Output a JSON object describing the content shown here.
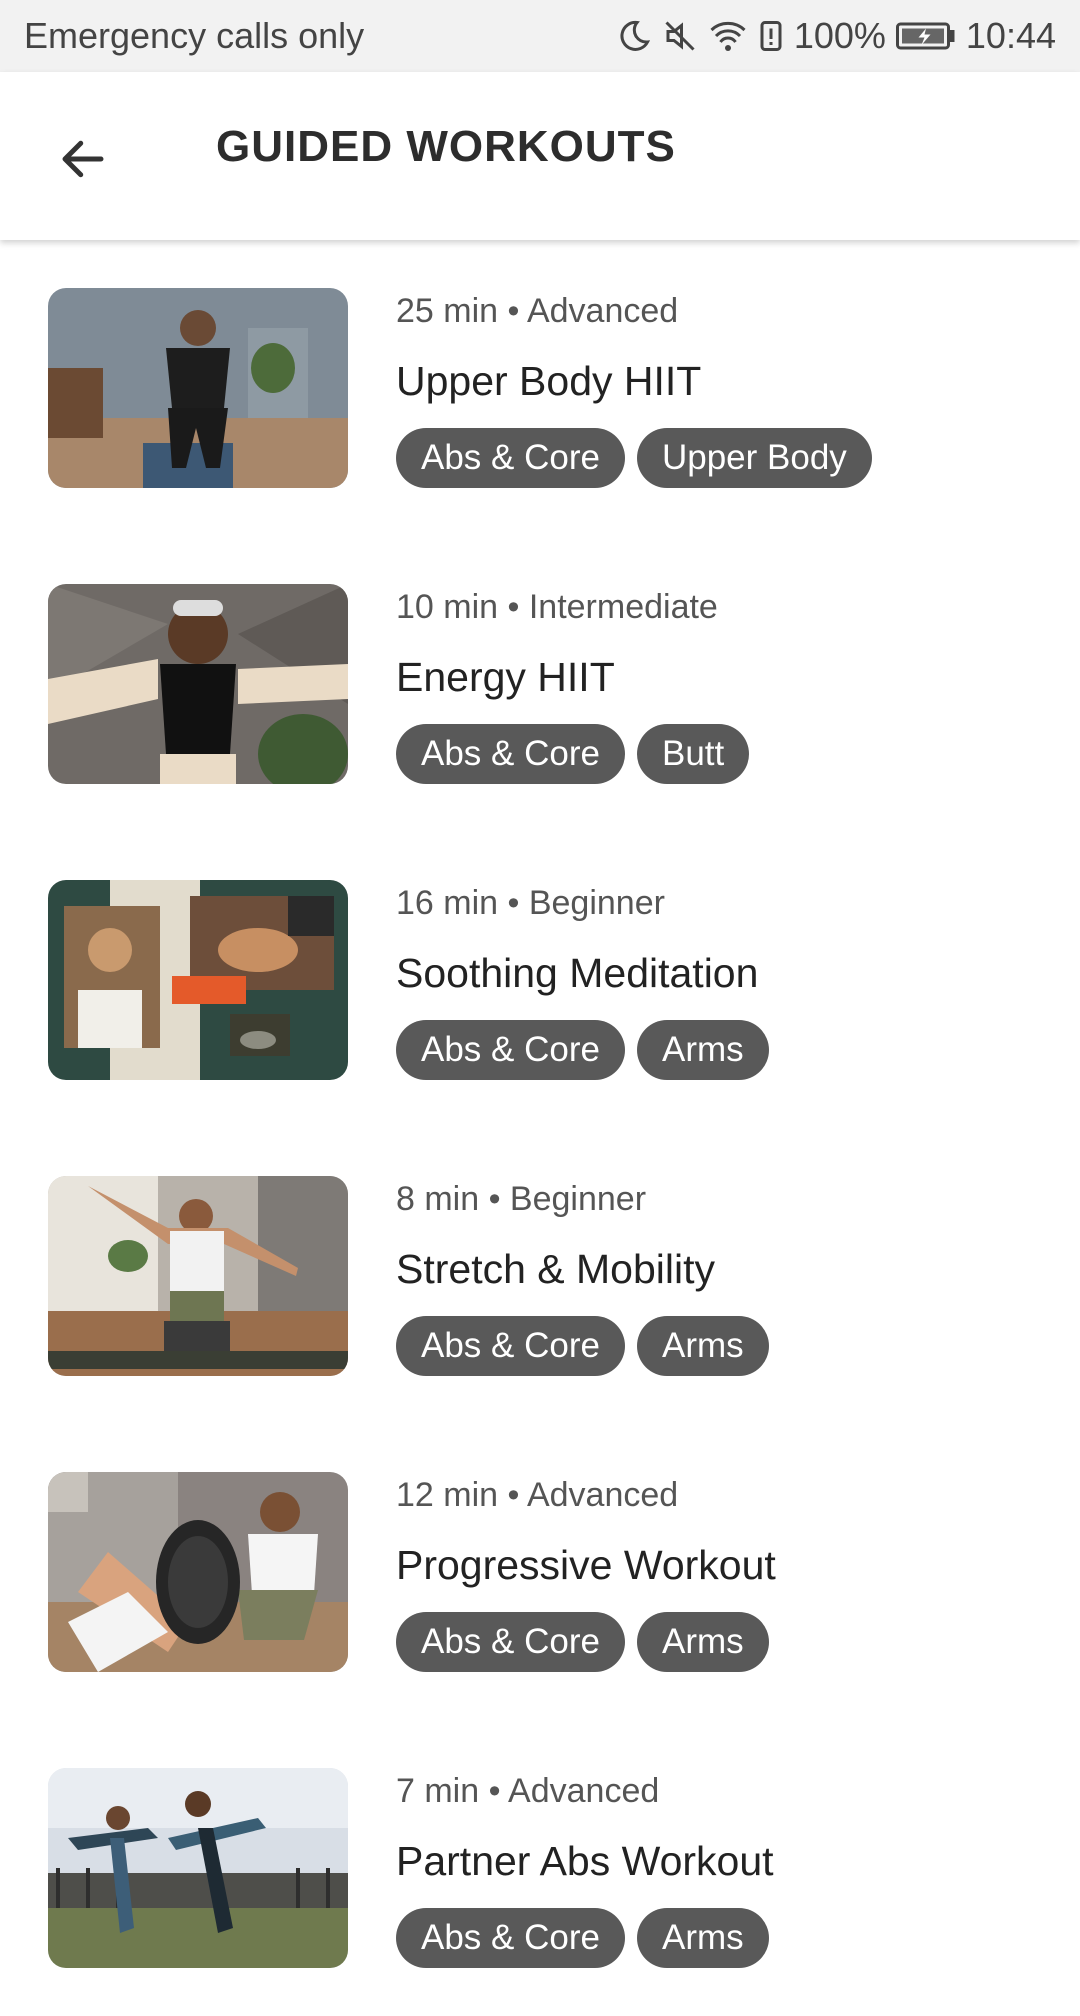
{
  "status_bar": {
    "carrier_text": "Emergency calls only",
    "battery": "100%",
    "time": "10:44",
    "icons": [
      "moon-icon",
      "mute-icon",
      "wifi-icon",
      "alert-icon",
      "battery-icon"
    ]
  },
  "header": {
    "back_icon": "arrow-left-icon",
    "title": "GUIDED WORKOUTS"
  },
  "colors": {
    "status_bg": "#f2f2f2",
    "tag_bg": "#595959",
    "tag_text": "#ffffff",
    "meta_text": "#555555"
  },
  "workouts": [
    {
      "meta": "25 min • Advanced",
      "title": "Upper Body HIIT",
      "tags": [
        "Abs & Core",
        "Upper Body"
      ]
    },
    {
      "meta": "10 min • Intermediate",
      "title": "Energy HIIT",
      "tags": [
        "Abs & Core",
        "Butt"
      ]
    },
    {
      "meta": "16 min • Beginner",
      "title": "Soothing Meditation",
      "tags": [
        "Abs & Core",
        "Arms"
      ]
    },
    {
      "meta": "8 min • Beginner",
      "title": "Stretch & Mobility",
      "tags": [
        "Abs & Core",
        "Arms"
      ]
    },
    {
      "meta": "12 min • Advanced",
      "title": "Progressive Workout",
      "tags": [
        "Abs & Core",
        "Arms"
      ]
    },
    {
      "meta": "7 min • Advanced",
      "title": "Partner Abs Workout",
      "tags": [
        "Abs & Core",
        "Arms"
      ]
    }
  ]
}
